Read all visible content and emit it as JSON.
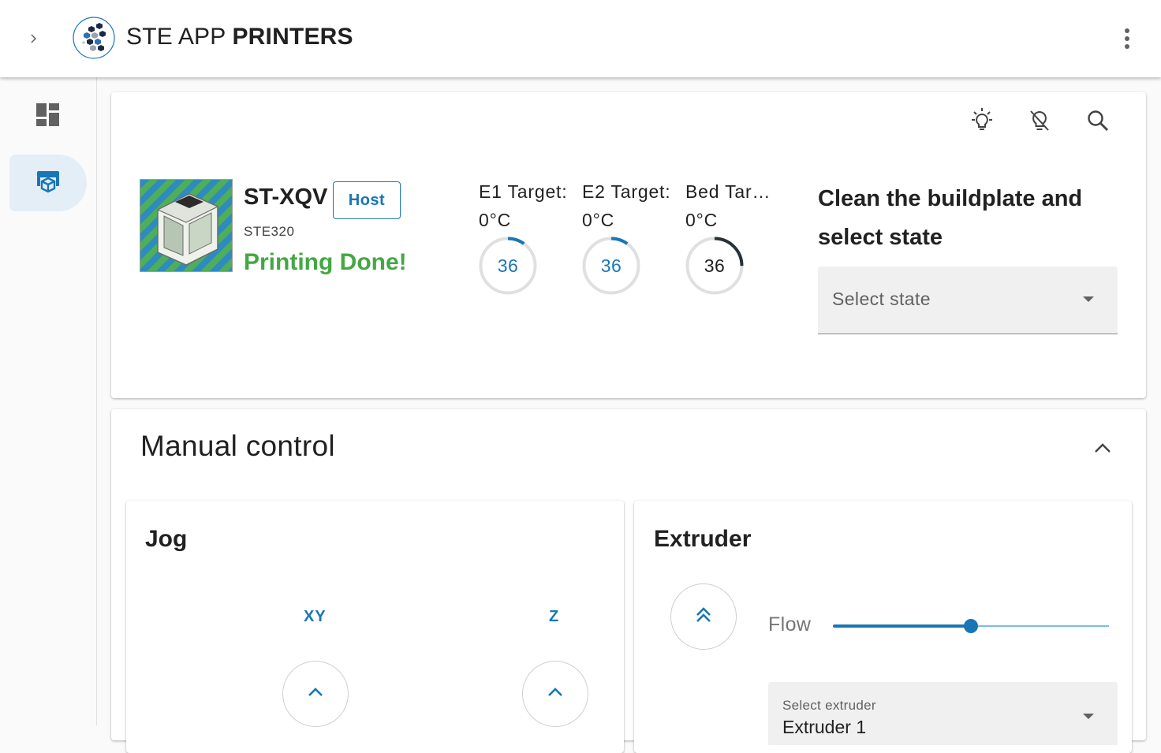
{
  "header": {
    "title_regular": "STE APP ",
    "title_bold": "PRINTERS",
    "expand_icon": "chevron-right-icon",
    "logo_icon": "hexagon-logo-icon",
    "more_icon": "more-vert-icon"
  },
  "sidebar": {
    "items": [
      {
        "name": "dashboard",
        "icon": "dashboard-icon",
        "active": false
      },
      {
        "name": "printers",
        "icon": "printer-icon",
        "active": true
      }
    ]
  },
  "printer_card": {
    "toolbar": [
      "lightbulb-on-icon",
      "lightbulb-off-icon",
      "search-icon"
    ],
    "name": "ST-XQV",
    "badge": "Host",
    "model": "STE320",
    "status": "Printing Done!",
    "temperatures": [
      {
        "label": "E1 Target:",
        "target": "0°C",
        "current": "36",
        "fraction": 0.1,
        "color": "#1976b6"
      },
      {
        "label": "E2 Target:",
        "target": "0°C",
        "current": "36",
        "fraction": 0.1,
        "color": "#1976b6"
      },
      {
        "label": "Bed Tar…",
        "target": "0°C",
        "current": "36",
        "fraction": 0.25,
        "color": "#263238"
      }
    ],
    "instruction": "Clean the buildplate and select state",
    "state_select": {
      "placeholder": "Select state"
    }
  },
  "manual_control": {
    "title": "Manual control",
    "jog": {
      "title": "Jog",
      "xy_label": "XY",
      "z_label": "Z"
    },
    "extruder": {
      "title": "Extruder",
      "flow_label": "Flow",
      "flow_fraction": 0.5,
      "select_label": "Select extruder",
      "select_value": "Extruder 1"
    }
  },
  "colors": {
    "accent": "#1976b6",
    "success": "#43a843",
    "nav_active_bg": "#e3eef7"
  }
}
